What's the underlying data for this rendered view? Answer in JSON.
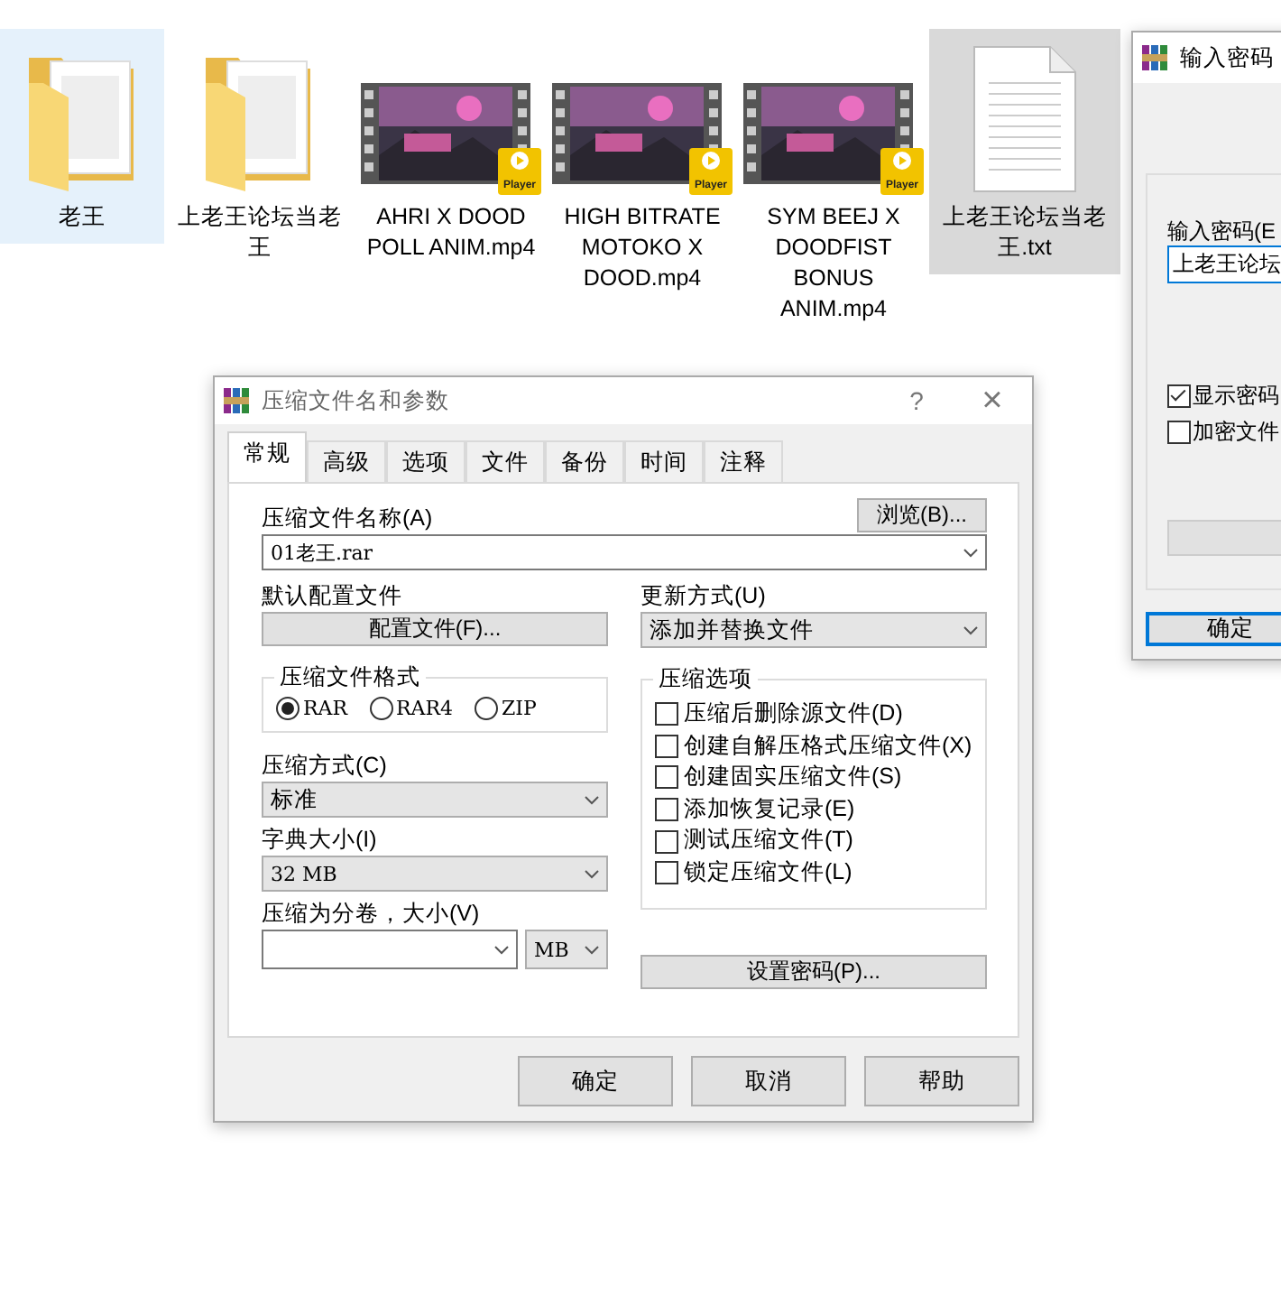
{
  "files": [
    {
      "kind": "folder",
      "name": "老王",
      "selected": true,
      "hovered": false
    },
    {
      "kind": "folder",
      "name": "上老王论坛当老王",
      "selected": false,
      "hovered": false
    },
    {
      "kind": "video",
      "name": "AHRI X DOOD POLL ANIM.mp4",
      "badge": "Player",
      "selected": false,
      "hovered": false
    },
    {
      "kind": "video",
      "name": "HIGH BITRATE MOTOKO X DOOD.mp4",
      "badge": "Player",
      "selected": false,
      "hovered": false
    },
    {
      "kind": "video",
      "name": "SYM BEEJ X DOODFIST BONUS ANIM.mp4",
      "badge": "Player",
      "selected": false,
      "hovered": false
    },
    {
      "kind": "text",
      "name": "上老王论坛当老王.txt",
      "selected": false,
      "hovered": true
    }
  ],
  "archive_dialog": {
    "title": "压缩文件名和参数",
    "help": "?",
    "close": "×",
    "tabs": [
      {
        "label": "常规",
        "selected": true
      },
      {
        "label": "高级",
        "selected": false
      },
      {
        "label": "选项",
        "selected": false
      },
      {
        "label": "文件",
        "selected": false
      },
      {
        "label": "备份",
        "selected": false
      },
      {
        "label": "时间",
        "selected": false
      },
      {
        "label": "注释",
        "selected": false
      }
    ],
    "archive_name_label": "压缩文件名称(A)",
    "browse_button": "浏览(B)...",
    "archive_name": "01老王.rar",
    "profile_label": "默认配置文件",
    "profile_button": "配置文件(F)...",
    "update_label": "更新方式(U)",
    "update_mode": "添加并替换文件",
    "format_label": "压缩文件格式",
    "formats": [
      {
        "label": "RAR",
        "selected": true
      },
      {
        "label": "RAR4",
        "selected": false
      },
      {
        "label": "ZIP",
        "selected": false
      }
    ],
    "method_label": "压缩方式(C)",
    "method": "标准",
    "dict_label": "字典大小(I)",
    "dict": "32 MB",
    "volume_label": "压缩为分卷，大小(V)",
    "volume_unit": "MB",
    "options_label": "压缩选项",
    "options": [
      {
        "label": "压缩后删除源文件(D)",
        "checked": false
      },
      {
        "label": "创建自解压格式压缩文件(X)",
        "checked": false
      },
      {
        "label": "创建固实压缩文件(S)",
        "checked": false
      },
      {
        "label": "添加恢复记录(E)",
        "checked": false
      },
      {
        "label": "测试压缩文件(T)",
        "checked": false
      },
      {
        "label": "锁定压缩文件(L)",
        "checked": false
      }
    ],
    "password_button": "设置密码(P)...",
    "buttons": [
      "确定",
      "取消",
      "帮助"
    ]
  },
  "password_dialog": {
    "title": "输入密码",
    "field_label": "输入密码(E",
    "value": "上老王论坛",
    "checks": [
      {
        "label": "显示密码",
        "checked": true
      },
      {
        "label": "加密文件",
        "checked": false
      }
    ],
    "ok_button": "确定"
  }
}
